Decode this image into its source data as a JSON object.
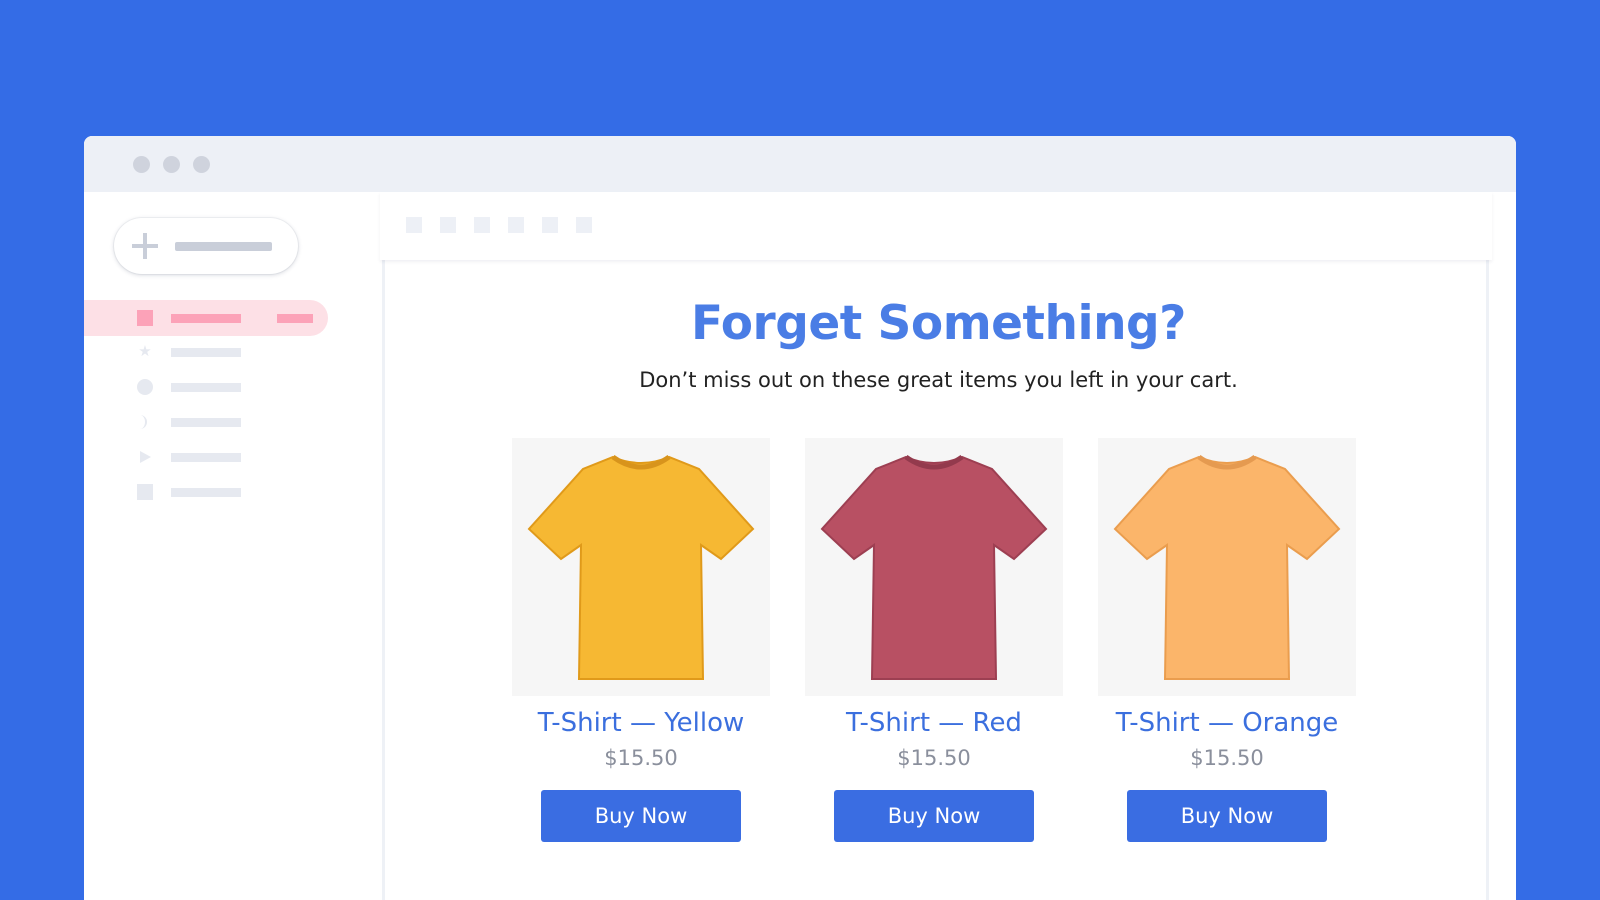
{
  "email": {
    "headline": "Forget Something?",
    "subtitle": "Don’t miss out on these great items you left in your cart.",
    "products": [
      {
        "name": "T-Shirt — Yellow",
        "price": "$15.50",
        "button": "Buy Now",
        "color": "#f6b833"
      },
      {
        "name": "T-Shirt — Red",
        "price": "$15.50",
        "button": "Buy Now",
        "color": "#b85063"
      },
      {
        "name": "T-Shirt — Orange",
        "price": "$15.50",
        "button": "Buy Now",
        "color": "#fbb56a"
      }
    ]
  },
  "colors": {
    "background": "#346ce6",
    "accent": "#3a6de2",
    "headline": "#4a7de5",
    "sidebar_active": "#fca2b8"
  },
  "sidebar": {
    "icons": [
      "inbox-icon",
      "star-icon",
      "clock-icon",
      "moon-icon",
      "send-icon",
      "draft-icon"
    ]
  }
}
